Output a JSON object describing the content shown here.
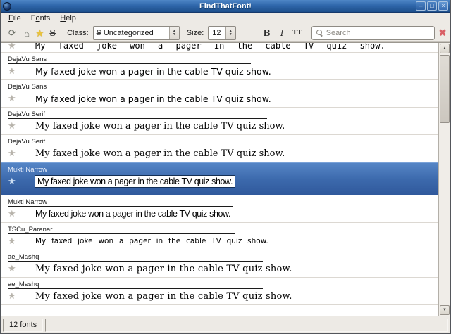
{
  "window": {
    "title": "FindThatFont!",
    "buttons": {
      "minimize": "–",
      "maximize": "□",
      "close": "×"
    }
  },
  "menu": {
    "items": [
      {
        "id": "file",
        "pre": "",
        "accel": "F",
        "post": "ile"
      },
      {
        "id": "fonts",
        "pre": "F",
        "accel": "o",
        "post": "nts"
      },
      {
        "id": "help",
        "pre": "",
        "accel": "H",
        "post": "elp"
      }
    ]
  },
  "toolbar": {
    "class_label": "Class:",
    "class_value": "Uncategorized",
    "size_label": "Size:",
    "size_value": "12",
    "bold_label": "B",
    "italic_label": "I",
    "smallcaps_label": "TT",
    "search_placeholder": "Search"
  },
  "icons": {
    "refresh": "⟳",
    "home": "⌂",
    "star": "★",
    "class_glyph": "S",
    "spinner_up": "▲",
    "spinner_down": "▼",
    "clear": "✖",
    "scroll_up": "▲",
    "scroll_down": "▼"
  },
  "list": {
    "sample_sentence": "My faxed joke won a pager in the cable TV quiz show.",
    "rows": [
      {
        "name": "",
        "font": "mono",
        "partial": true,
        "selected": false,
        "underline": 0
      },
      {
        "name": "DejaVu Sans",
        "font": "sans",
        "partial": false,
        "selected": false,
        "underline": 345
      },
      {
        "name": "DejaVu Sans",
        "font": "sans",
        "partial": false,
        "selected": false,
        "underline": 345
      },
      {
        "name": "DejaVu Serif",
        "font": "serif",
        "partial": false,
        "selected": false,
        "underline": 368
      },
      {
        "name": "DejaVu Serif",
        "font": "serif",
        "partial": false,
        "selected": false,
        "underline": 368
      },
      {
        "name": "Mukti Narrow",
        "font": "narrow",
        "partial": false,
        "selected": true,
        "underline": 0
      },
      {
        "name": "Mukti Narrow",
        "font": "narrow",
        "partial": false,
        "selected": false,
        "underline": 320
      },
      {
        "name": "TSCu_Paranar",
        "font": "paranar",
        "partial": false,
        "selected": false,
        "underline": 322
      },
      {
        "name": "ae_Mashq",
        "font": "mashq",
        "partial": false,
        "selected": false,
        "underline": 362
      },
      {
        "name": "ae_Mashq",
        "font": "mashq",
        "partial": false,
        "selected": false,
        "underline": 362
      }
    ]
  },
  "statusbar": {
    "count": "12 fonts"
  },
  "colors": {
    "titlebar_blue": "#2f67ab",
    "selection_blue": "#3b68ab",
    "star_gold": "#e9c33f",
    "clear_red": "#d95f66",
    "chrome_gray": "#edeae5"
  }
}
